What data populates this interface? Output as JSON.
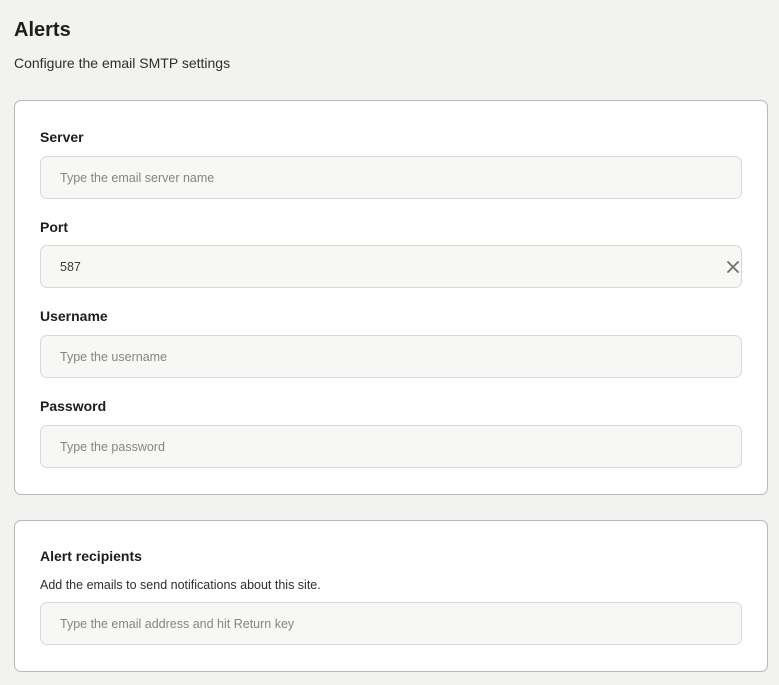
{
  "header": {
    "title": "Alerts",
    "subtitle": "Configure the email SMTP settings"
  },
  "smtp": {
    "server": {
      "label": "Server",
      "value": "",
      "placeholder": "Type the email server name"
    },
    "port": {
      "label": "Port",
      "value": "587",
      "placeholder": "",
      "clear_icon": "close-icon"
    },
    "username": {
      "label": "Username",
      "value": "",
      "placeholder": "Type the username"
    },
    "password": {
      "label": "Password",
      "value": "",
      "placeholder": "Type the password"
    }
  },
  "recipients": {
    "title": "Alert recipients",
    "description": "Add the emails to send notifications about this site.",
    "input": {
      "value": "",
      "placeholder": "Type the email address and hit Return key"
    }
  },
  "colors": {
    "background": "#f2f2f0",
    "card_border": "#b9b9b4",
    "input_background": "#f7f7f5",
    "text": "#1d1d1b",
    "placeholder": "#858580"
  }
}
